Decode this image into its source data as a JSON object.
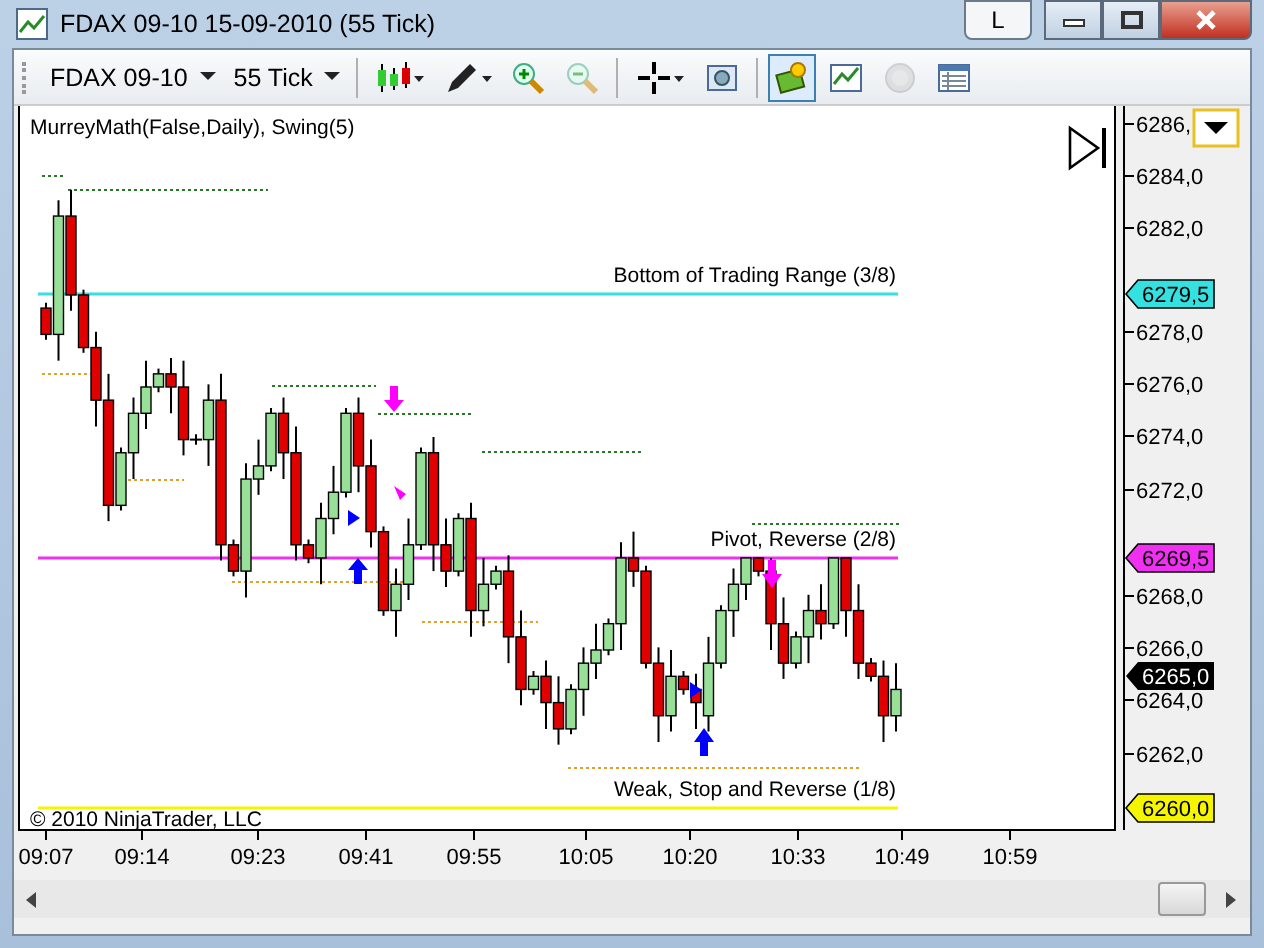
{
  "window": {
    "title": "FDAX 09-10  15-09-2010 (55 Tick)",
    "layout_button": "L"
  },
  "toolbar": {
    "instrument": "FDAX 09-10",
    "interval": "55 Tick",
    "items": [
      {
        "kind": "candles",
        "selected": false,
        "disabled": false
      },
      {
        "kind": "pen",
        "selected": false,
        "disabled": false
      },
      {
        "kind": "zoom-in",
        "selected": false,
        "disabled": false
      },
      {
        "kind": "zoom-out",
        "selected": false,
        "disabled": true
      },
      {
        "kind": "crosshair",
        "selected": false,
        "disabled": false
      },
      {
        "kind": "snapshot",
        "selected": false,
        "disabled": false
      },
      {
        "kind": "strategy",
        "selected": true,
        "disabled": false
      },
      {
        "kind": "chart",
        "selected": false,
        "disabled": false
      },
      {
        "kind": "coin",
        "selected": false,
        "disabled": true
      },
      {
        "kind": "table",
        "selected": false,
        "disabled": false
      }
    ]
  },
  "chart": {
    "indicator_label": "MurreyMath(False,Daily), Swing(5)",
    "copyright": "© 2010 NinjaTrader, LLC",
    "levels": [
      {
        "label": "Bottom of Trading Range (3/8)",
        "color": "#35e0e0",
        "marker": "6279,5"
      },
      {
        "label": "Pivot, Reverse (2/8)",
        "color": "#f030f0",
        "marker": "6269,5"
      },
      {
        "label": "Weak, Stop and Reverse (1/8)",
        "color": "#f5f500",
        "marker": "6260,0"
      }
    ],
    "last_price": "6265,0",
    "price_labels": [
      "6286,",
      "6284,0",
      "6282,0",
      "6278,0",
      "6276,0",
      "6274,0",
      "6272,0",
      "6268,0",
      "6266,0",
      "6264,0",
      "6262,0"
    ],
    "time_labels": [
      "09:07",
      "09:14",
      "09:23",
      "09:41",
      "09:55",
      "10:05",
      "10:20",
      "10:33",
      "10:49",
      "10:59"
    ]
  }
}
